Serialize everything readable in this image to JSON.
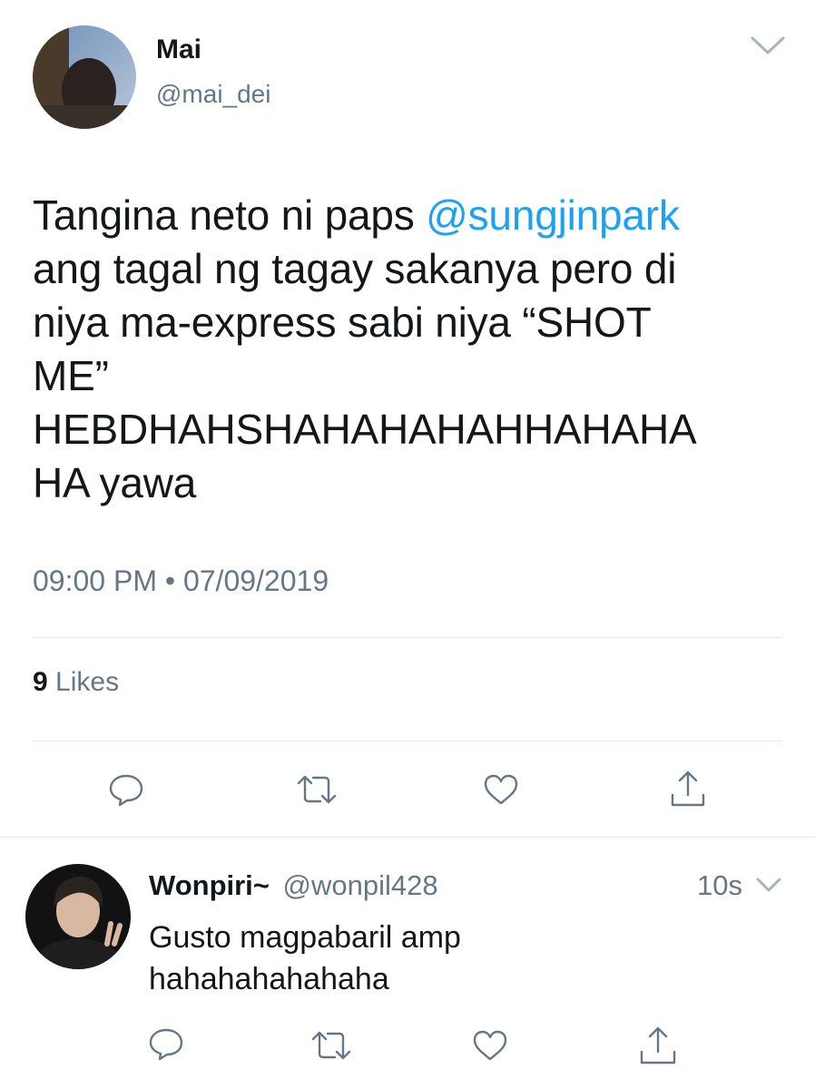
{
  "tweet": {
    "author_name": "Mai",
    "author_handle": "@mai_dei",
    "text_before_mention": "Tangina neto ni paps ",
    "mention": "@sungjinpark",
    "text_line2": "ang tagal ng tagay sakanya pero di",
    "text_line3": "niya ma-express sabi niya “SHOT",
    "text_line4": "ME”",
    "text_line5": "HEBDHAHSHAHAHAHAHHAHAHA",
    "text_line6": "HA yawa",
    "timestamp": "09:00 PM • 07/09/2019",
    "likes_count": "9",
    "likes_label": "Likes",
    "actions": [
      "reply-icon",
      "retweet-icon",
      "like-icon",
      "share-icon"
    ]
  },
  "reply": {
    "author_name": "Wonpiri~",
    "author_handle": "@wonpil428",
    "time_ago": "10s",
    "text_line1": "Gusto magpabaril amp",
    "text_line2": "hahahahahahaha",
    "actions": [
      "reply-icon",
      "retweet-icon",
      "like-icon",
      "share-icon"
    ]
  },
  "colors": {
    "mention": "#1da1f2",
    "secondary_text": "#657786",
    "divider": "#e1e8ed"
  }
}
